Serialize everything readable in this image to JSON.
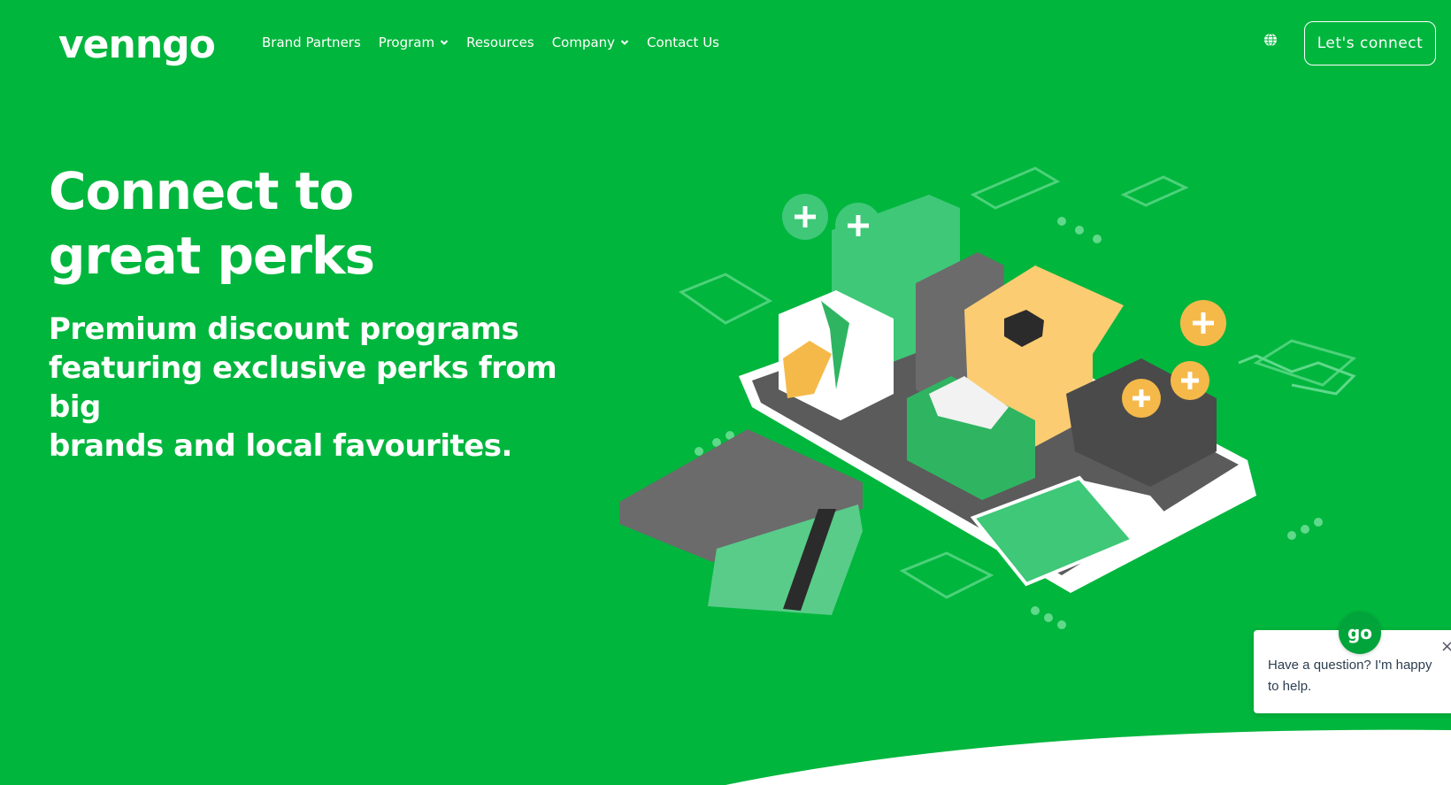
{
  "brand": {
    "logo_text": "venngo",
    "accent_color": "#01b63d"
  },
  "nav": {
    "items": [
      {
        "label": "Brand Partners",
        "has_dropdown": false
      },
      {
        "label": "Program",
        "has_dropdown": true
      },
      {
        "label": "Resources",
        "has_dropdown": false
      },
      {
        "label": "Company",
        "has_dropdown": true
      },
      {
        "label": "Contact Us",
        "has_dropdown": false
      }
    ],
    "globe_icon": "globe-icon",
    "cta_label": "Let's connect"
  },
  "hero": {
    "title_line1": "Connect to",
    "title_line2": "great perks",
    "subtitle_line1": "Premium discount programs",
    "subtitle_line2": "featuring exclusive perks from big",
    "subtitle_line3": "brands and local favourites."
  },
  "chat": {
    "message": "Have a question? I'm happy to help.",
    "avatar_text": "go",
    "close_icon": "close-icon",
    "launcher_icon": "chat-bubble-icon"
  }
}
